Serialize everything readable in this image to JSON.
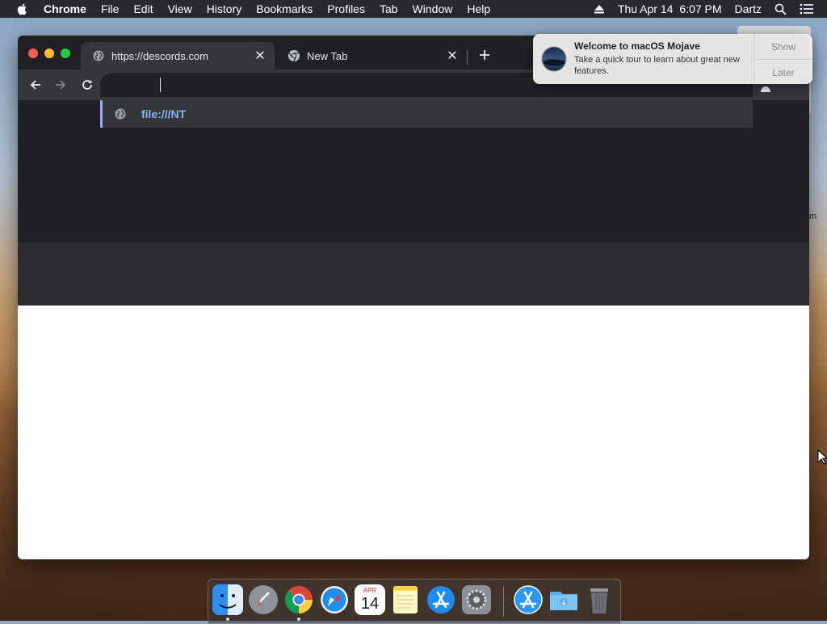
{
  "menubar": {
    "apple_icon": "apple-icon",
    "items": [
      "Chrome",
      "File",
      "Edit",
      "View",
      "History",
      "Bookmarks",
      "Profiles",
      "Tab",
      "Window",
      "Help"
    ],
    "date": "Thu Apr 14",
    "time": "6:07 PM",
    "user": "Dartz"
  },
  "browser": {
    "tabs": [
      {
        "title": "https://descords.com",
        "icon": "globe-icon",
        "active": true
      },
      {
        "title": "New Tab",
        "icon": "chrome-icon",
        "active": false
      }
    ],
    "omnibox_value": "",
    "suggestion": "file:///NT"
  },
  "notification": {
    "title": "Welcome to macOS Mojave",
    "body": "Take a quick tour to learn about great new features.",
    "show_label": "Show",
    "later_label": "Later"
  },
  "background": {
    "partial_text": "m"
  },
  "dock": {
    "calendar_month": "APR",
    "calendar_day": "14",
    "apps": [
      "finder",
      "launchpad",
      "chrome",
      "safari",
      "calendar",
      "notes",
      "app-store",
      "system-preferences",
      "app-store-downloads",
      "downloads-folder",
      "trash"
    ]
  },
  "colors": {
    "accent": "#8ab4f8",
    "tab_bg": "#202124",
    "toolbar_bg": "#35363a"
  }
}
